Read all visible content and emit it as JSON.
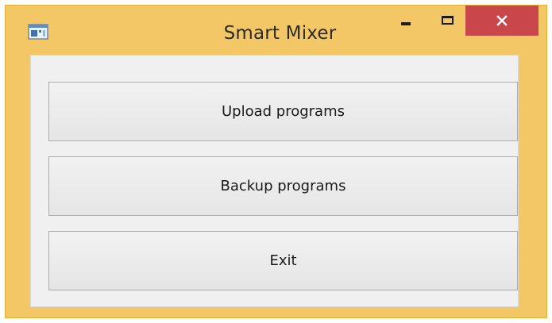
{
  "window": {
    "title": "Smart Mixer",
    "app_icon": "app-window-icon",
    "frame_color": "#f3c766",
    "close_color": "#c9474a"
  },
  "controls": {
    "minimize_icon": "minimize-icon",
    "maximize_icon": "maximize-icon",
    "close_icon": "close-icon"
  },
  "buttons": {
    "upload_label": "Upload programs",
    "backup_label": "Backup programs",
    "exit_label": "Exit"
  }
}
